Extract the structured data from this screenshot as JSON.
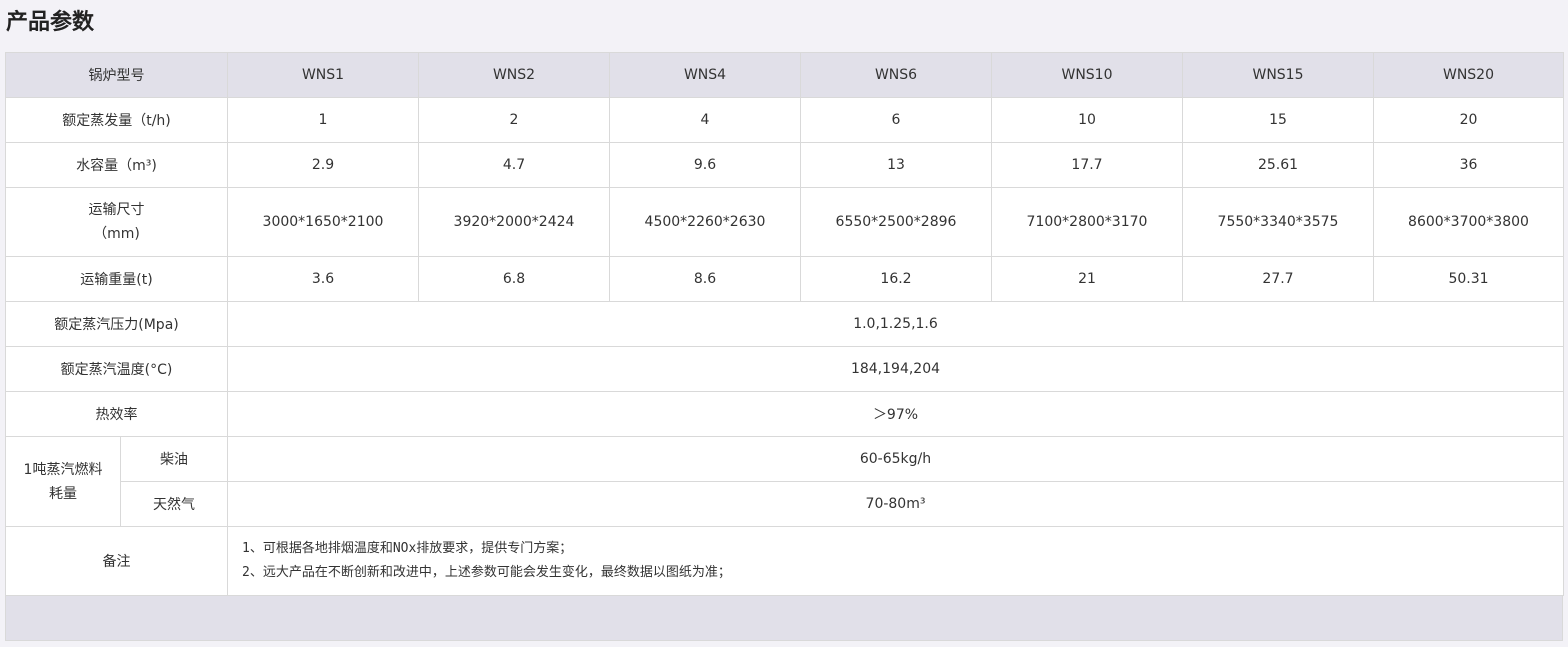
{
  "page_title": "产品参数",
  "table": {
    "header_label": "锅炉型号",
    "models": [
      "WNS1",
      "WNS2",
      "WNS4",
      "WNS6",
      "WNS10",
      "WNS15",
      "WNS20"
    ],
    "per_model_rows": [
      {
        "label": "额定蒸发量（t/h)",
        "values": [
          "1",
          "2",
          "4",
          "6",
          "10",
          "15",
          "20"
        ]
      },
      {
        "label": "水容量（m³)",
        "values": [
          "2.9",
          "4.7",
          "9.6",
          "13",
          "17.7",
          "25.61",
          "36"
        ]
      },
      {
        "label_line1": "运输尺寸",
        "label_line2": "（mm)",
        "values": [
          "3000*1650*2100",
          "3920*2000*2424",
          "4500*2260*2630",
          "6550*2500*2896",
          "7100*2800*3170",
          "7550*3340*3575",
          "8600*3700*3800"
        ]
      },
      {
        "label": "运输重量(t)",
        "values": [
          "3.6",
          "6.8",
          "8.6",
          "16.2",
          "21",
          "27.7",
          "50.31"
        ]
      }
    ],
    "shared_rows": [
      {
        "label": "额定蒸汽压力(Mpa)",
        "value": "1.0,1.25,1.6"
      },
      {
        "label": "额定蒸汽温度(°C)",
        "value": "184,194,204"
      },
      {
        "label": "热效率",
        "value": "＞97%"
      }
    ],
    "fuel": {
      "group_label_line1": "1吨蒸汽燃料",
      "group_label_line2": "耗量",
      "rows": [
        {
          "label": "柴油",
          "value": "60-65kg/h"
        },
        {
          "label": "天然气",
          "value": "70-80m³"
        }
      ]
    },
    "notes": {
      "label": "备注",
      "lines": [
        "1、可根据各地排烟温度和NOx排放要求，提供专门方案；",
        "2、远大产品在不断创新和改进中，上述参数可能会发生变化，最终数据以图纸为准；"
      ]
    }
  }
}
